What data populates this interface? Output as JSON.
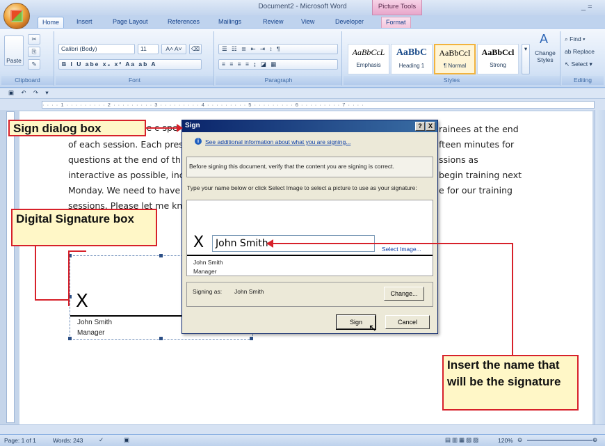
{
  "window": {
    "title": "Document2 - Microsoft Word",
    "context_tab_group": "Picture Tools",
    "minimize_label": "_ ="
  },
  "tabs": [
    "Home",
    "Insert",
    "Page Layout",
    "References",
    "Mailings",
    "Review",
    "View",
    "Developer",
    "Format"
  ],
  "ribbon": {
    "clipboard": {
      "label": "Clipboard",
      "paste": "Paste"
    },
    "font": {
      "label": "Font",
      "name": "Calibri (Body)",
      "size": "11"
    },
    "paragraph": {
      "label": "Paragraph"
    },
    "styles": {
      "label": "Styles",
      "items": [
        {
          "sample": "AaBbCcL",
          "name": "Emphasis"
        },
        {
          "sample": "AaBbC",
          "name": "Heading 1"
        },
        {
          "sample": "AaBbCcI",
          "name": "¶ Normal"
        },
        {
          "sample": "AaBbCcl",
          "name": "Strong"
        }
      ],
      "change_styles": "Change Styles"
    },
    "editing": {
      "label": "Editing",
      "find": "Find",
      "replace": "Replace",
      "select": "Select"
    }
  },
  "document": {
    "lines": [
      "presentation at the c-spe",
      "of each session. Each pres",
      "questions at the end of th",
      "interactive as possible, inc",
      "Monday. We need to have",
      "sessions. Please let me kno"
    ],
    "lines_right": [
      "rainees at the end",
      "fteen minutes for",
      "ssions as",
      "begin training next",
      "e for our training"
    ],
    "signature_box": {
      "x_mark": "X",
      "name": "John Smith",
      "title": "Manager"
    }
  },
  "dialog": {
    "title": "Sign",
    "help": "?",
    "close": "X",
    "info_link": "See additional information about what you are signing...",
    "verify_text": "Before signing this document, verify that the content you are signing is correct.",
    "instruction": "Type your name below or click Select Image to select a picture to use as your signature:",
    "x_mark": "X",
    "name_value": "John Smith",
    "select_image": "Select Image...",
    "signer_name": "John Smith",
    "signer_title": "Manager",
    "signing_as_label": "Signing as:",
    "signing_as_value": "John Smith",
    "change_button": "Change...",
    "sign_button": "Sign",
    "cancel_button": "Cancel"
  },
  "callouts": {
    "sign_dialog": "Sign dialog box",
    "digital_signature": "Digital Signature box",
    "insert_name": "Insert the name that will be the signature"
  },
  "status": {
    "page": "Page: 1 of 1",
    "words": "Words: 243",
    "zoom": "120%"
  },
  "colors": {
    "callout_border": "#d7212a",
    "callout_fill": "#fff7c7",
    "dialog_title": "#0a246a"
  }
}
